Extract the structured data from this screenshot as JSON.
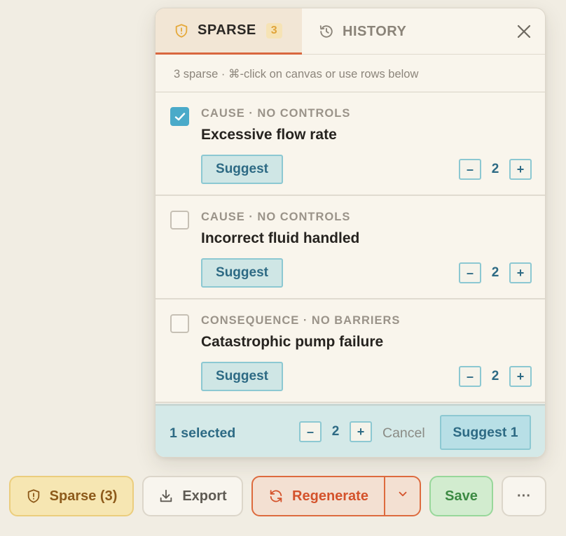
{
  "panel": {
    "tabs": [
      {
        "label": "SPARSE",
        "count": "3",
        "icon": "shield-alert-icon",
        "active": true
      },
      {
        "label": "HISTORY",
        "icon": "history-icon",
        "active": false
      }
    ],
    "close_icon": "close-icon",
    "hint": "3 sparse · ⌘-click on canvas or use rows below",
    "rows": [
      {
        "kind": "CAUSE · NO CONTROLS",
        "title": "Excessive flow rate",
        "checked": true,
        "suggest_label": "Suggest",
        "count": "2"
      },
      {
        "kind": "CAUSE · NO CONTROLS",
        "title": "Incorrect fluid handled",
        "checked": false,
        "suggest_label": "Suggest",
        "count": "2"
      },
      {
        "kind": "CONSEQUENCE · NO BARRIERS",
        "title": "Catastrophic pump failure",
        "checked": false,
        "suggest_label": "Suggest",
        "count": "2"
      }
    ],
    "stepper": {
      "minus": "–",
      "plus": "+"
    },
    "footer": {
      "selected": "1 selected",
      "count": "2",
      "cancel": "Cancel",
      "suggest": "Suggest 1"
    }
  },
  "toolbar": {
    "sparse": "Sparse (3)",
    "export": "Export",
    "regenerate": "Regenerate",
    "save": "Save",
    "more": "···"
  },
  "colors": {
    "accent_orange": "#d9673f",
    "teal": "#2d6a84",
    "check_blue": "#4aaac9"
  }
}
